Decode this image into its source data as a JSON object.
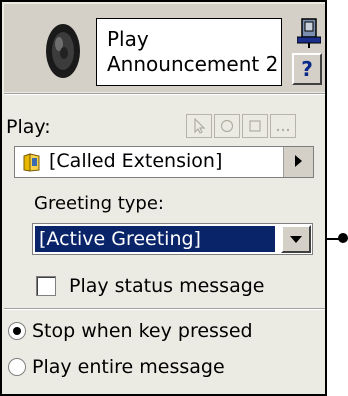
{
  "header": {
    "title_line1": "Play",
    "title_line2": "Announcement 2",
    "help_label": "?"
  },
  "play_section": {
    "label": "Play:",
    "source_value": "[Called Extension]"
  },
  "greeting": {
    "label": "Greeting type:",
    "selected": "[Active Greeting]"
  },
  "status_checkbox": {
    "label": "Play status message",
    "checked": false
  },
  "playback_mode": {
    "options": [
      {
        "label": "Stop when key pressed",
        "selected": true
      },
      {
        "label": "Play entire message",
        "selected": false
      }
    ]
  },
  "colors": {
    "panel_bg": "#ecebe3",
    "header_bg": "#d4d0c8",
    "selection_bg": "#0a246a"
  }
}
